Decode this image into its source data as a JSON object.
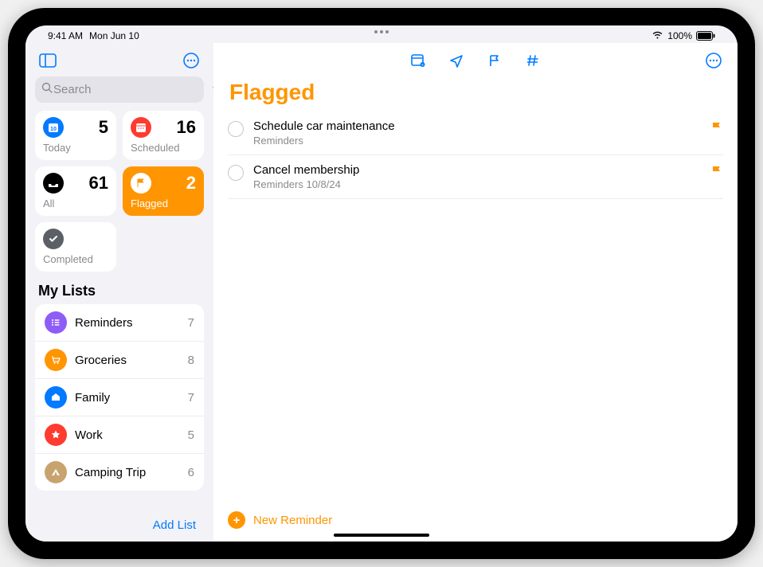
{
  "status": {
    "time": "9:41 AM",
    "date": "Mon Jun 10",
    "battery_pct": "100%"
  },
  "sidebar": {
    "search_placeholder": "Search",
    "smart": {
      "today": {
        "label": "Today",
        "count": "5"
      },
      "scheduled": {
        "label": "Scheduled",
        "count": "16"
      },
      "all": {
        "label": "All",
        "count": "61"
      },
      "flagged": {
        "label": "Flagged",
        "count": "2"
      },
      "completed": {
        "label": "Completed"
      }
    },
    "lists_title": "My Lists",
    "lists": [
      {
        "name": "Reminders",
        "count": "7",
        "color": "#8e5cf7"
      },
      {
        "name": "Groceries",
        "count": "8",
        "color": "#ff9500"
      },
      {
        "name": "Family",
        "count": "7",
        "color": "#007aff"
      },
      {
        "name": "Work",
        "count": "5",
        "color": "#ff3b30"
      },
      {
        "name": "Camping Trip",
        "count": "6",
        "color": "#c8a36f"
      }
    ],
    "add_list": "Add List"
  },
  "main": {
    "title": "Flagged",
    "title_color": "#ff9500",
    "reminders": [
      {
        "title": "Schedule car maintenance",
        "sub": "Reminders"
      },
      {
        "title": "Cancel membership",
        "sub": "Reminders  10/8/24"
      }
    ],
    "new_reminder": "New Reminder"
  }
}
